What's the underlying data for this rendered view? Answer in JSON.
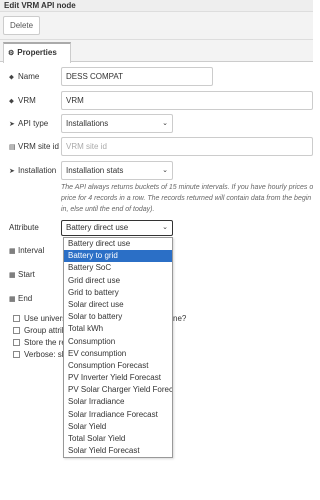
{
  "window": {
    "title": "Edit VRM API node"
  },
  "toolbar": {
    "delete_label": "Delete"
  },
  "tabs": [
    {
      "label": "Properties",
      "icon": "gear-icon"
    }
  ],
  "form": {
    "name": {
      "label": "Name",
      "value": "DESS COMPAT",
      "icon": "tag-icon"
    },
    "vrm": {
      "label": "VRM",
      "value": "VRM",
      "icon": "tag-icon"
    },
    "api_type": {
      "label": "API type",
      "value": "Installations",
      "icon": "arrow-icon"
    },
    "site_id": {
      "label": "VRM site id",
      "placeholder": "VRM site id",
      "icon": "id-card-icon"
    },
    "installation": {
      "label": "Installation",
      "value": "Installation stats",
      "icon": "arrow-icon"
    },
    "help_lines": [
      "The API always returns buckets of 15 minute intervals. If you have hourly prices o",
      "price for 4 records in a row. The records returned will contain data from the begin",
      "in, else until the end of today)."
    ],
    "attribute": {
      "label": "Attribute",
      "value": "Battery direct use"
    },
    "interval": {
      "label": "Interval",
      "icon": "grid-icon"
    },
    "start": {
      "label": "Start",
      "icon": "calendar-icon"
    },
    "end": {
      "label": "End",
      "icon": "calendar-icon"
    },
    "checkboxes": [
      {
        "label": "Use univers",
        "suffix": "ne?"
      },
      {
        "label": "Group attrib"
      },
      {
        "label": "Store the res"
      },
      {
        "label": "Verbose: sho"
      }
    ]
  },
  "dropdown": {
    "selected_index": 1,
    "options": [
      "Battery direct use",
      "Battery to grid",
      "Battery SoC",
      "Grid direct use",
      "Grid to battery",
      "Solar direct use",
      "Solar to battery",
      "Total kWh",
      "Consumption",
      "EV consumption",
      "Consumption Forecast",
      "PV Inverter Yield Forecast",
      "PV Solar Charger Yield Forecast",
      "Solar Irradiance",
      "Solar Irradiance Forecast",
      "Solar Yield",
      "Total Solar Yield",
      "Solar Yield Forecast"
    ]
  }
}
